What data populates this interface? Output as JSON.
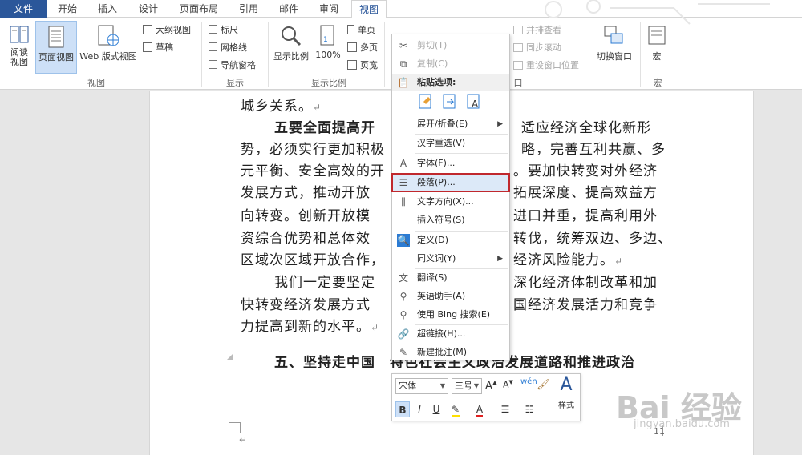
{
  "tabs": [
    "文件",
    "开始",
    "插入",
    "设计",
    "页面布局",
    "引用",
    "邮件",
    "审阅",
    "视图"
  ],
  "ribbon": {
    "view_group": {
      "reading_view": "阅读\n视图",
      "reading_view_l1": "阅读",
      "reading_view_l2": "视图",
      "page_view": "页面视图",
      "web_view": "Web 版式视图",
      "outline": "大纲视图",
      "draft": "草稿",
      "label": "视图"
    },
    "show_group": {
      "ruler": "标尺",
      "gridlines": "网格线",
      "nav_pane": "导航窗格",
      "label": "显示"
    },
    "zoom_group": {
      "zoom": "显示比例",
      "hundred": "100%",
      "one_page": "单页",
      "multi_page": "多页",
      "page_width": "页宽",
      "label": "显示比例"
    },
    "window_group": {
      "side_by_side": "并排查看",
      "sync_scroll": "同步滚动",
      "reset_pos": "重设窗口位置",
      "switch": "切换窗口",
      "label": "窗口",
      "label_visible": "口"
    },
    "macro_group": {
      "macro": "宏",
      "label": "宏"
    }
  },
  "document": {
    "lines": [
      "城乡关系。",
      "五要全面提高开",
      "适应经济全球化新形",
      "势，必须实行更加积极",
      "略，完善互利共赢、多",
      "元平衡、安全高效的开",
      "。要加快转变对外经济",
      "发展方式，推动开放",
      "拓展深度、提高效益方",
      "向转变。创新开放模",
      "进口并重，提高利用外",
      "资综合优势和总体效",
      "转伐，统筹双边、多边、",
      "区域次区域开放合作，",
      "经济风险能力。",
      "我们一定要坚定",
      "深化经济体制改革和加",
      "快转变经济发展方式",
      "国经济发展活力和竞争",
      "力提高到新的水平。",
      "五、坚持走中国",
      "特色社会主义政治发展道路和推进政治"
    ],
    "para_mark": "↵",
    "page_number": "11"
  },
  "context_menu": {
    "cut": "剪切(T)",
    "copy": "复制(C)",
    "paste_options": "粘贴选项:",
    "expand_collapse": "展开/折叠(E)",
    "reconvert": "汉字重选(V)",
    "font": "字体(F)...",
    "paragraph": "段落(P)...",
    "text_direction": "文字方向(X)...",
    "insert_symbol": "插入符号(S)",
    "define": "定义(D)",
    "synonyms": "同义词(Y)",
    "translate": "翻译(S)",
    "english_assistant": "英语助手(A)",
    "bing_search": "使用 Bing 搜索(E)",
    "hyperlink": "超链接(H)...",
    "new_comment": "新建批注(M)"
  },
  "mini_toolbar": {
    "font_name": "宋体",
    "font_size": "三号",
    "styles": "样式",
    "bold": "B",
    "italic": "I",
    "underline": "U"
  },
  "watermark": {
    "brand": "Bai 经验",
    "url": "jingyan.baidu.com"
  },
  "colors": {
    "file_tab": "#2b579a",
    "highlight_border": "#c0282d",
    "selected_bg": "#cde0f7"
  }
}
